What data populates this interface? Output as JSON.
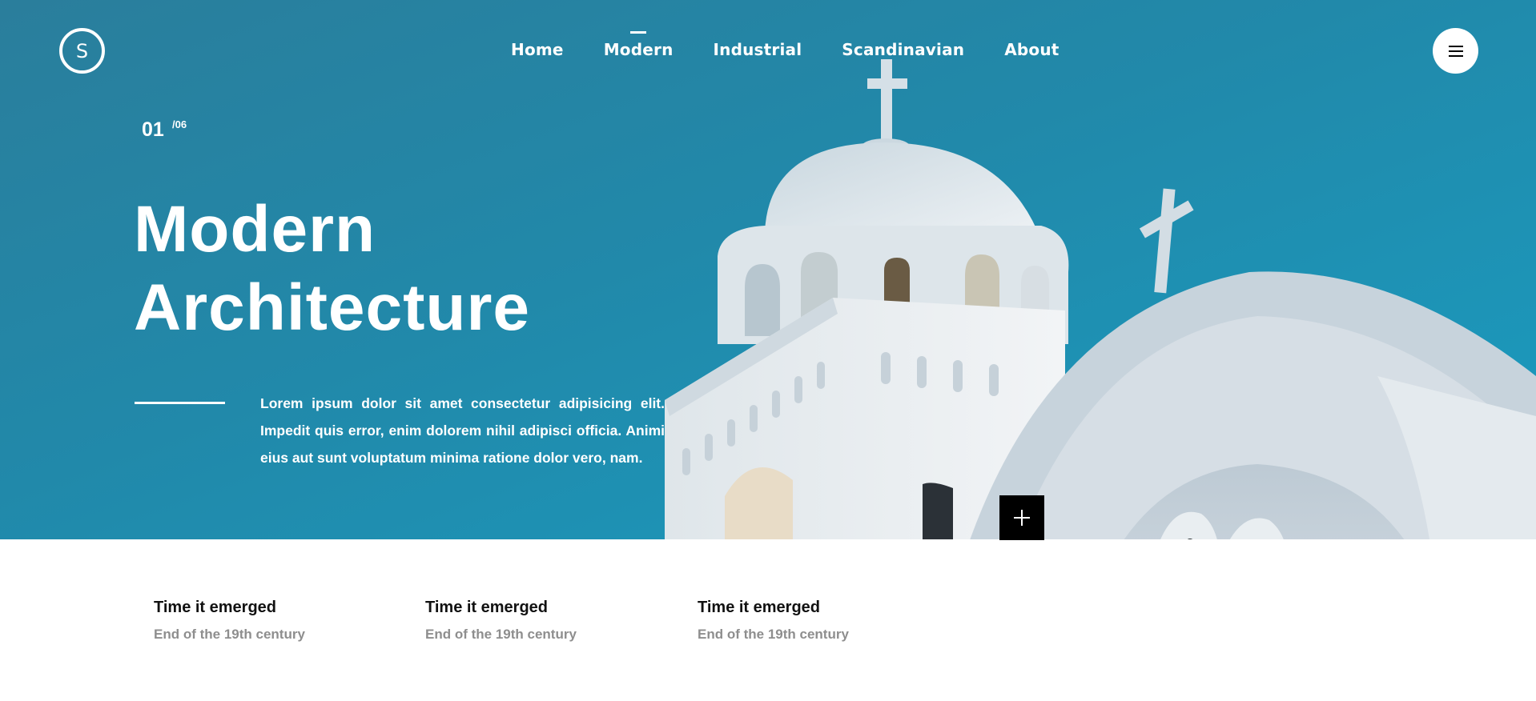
{
  "header": {
    "logo_letter": "S",
    "nav": [
      {
        "label": "Home",
        "active": false
      },
      {
        "label": "Modern",
        "active": true
      },
      {
        "label": "Industrial",
        "active": false
      },
      {
        "label": "Scandinavian",
        "active": false
      },
      {
        "label": "About",
        "active": false
      }
    ],
    "menu_icon": "hamburger-icon"
  },
  "hero": {
    "counter_current": "01",
    "counter_total": "/06",
    "title_line1": "Modern",
    "title_line2": "Architecture",
    "description": "Lorem ipsum dolor sit amet consectetur adipisicing elit. Impedit quis error, enim dolorem nihil adipisci officia. Animi eius aut sunt voluptatum minima ratione dolor vero, nam.",
    "expand_icon": "plus-icon"
  },
  "features": [
    {
      "title": "Time it emerged",
      "value": "End of the 19th century"
    },
    {
      "title": "Time it emerged",
      "value": "End of the 19th century"
    },
    {
      "title": "Time it emerged",
      "value": "End of the 19th century"
    }
  ],
  "colors": {
    "sky": "#2189aa",
    "church_white": "#e6edf2",
    "text_white": "#ffffff",
    "feature_title": "#111111",
    "feature_value": "#8e8e8e"
  }
}
